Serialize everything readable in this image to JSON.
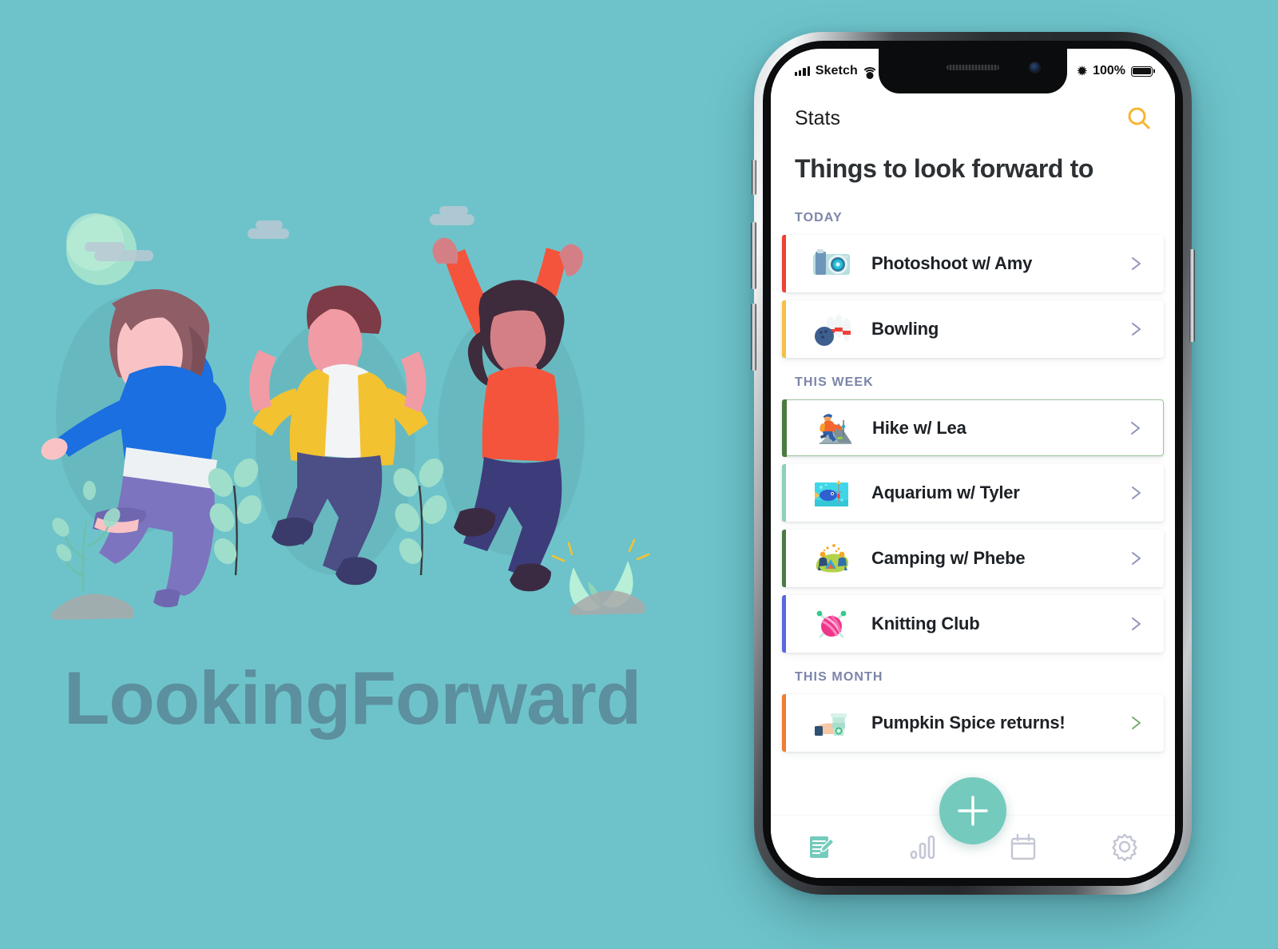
{
  "background": {
    "brand_title": "LookingForward",
    "bg_color": "#6ec3ca",
    "brand_color": "#5b8c9b"
  },
  "status_bar": {
    "carrier": "Sketch",
    "battery_percent": "100%",
    "signal_icon": "signal-bars-icon",
    "wifi_icon": "wifi-icon",
    "bluetooth_icon": "bluetooth-icon",
    "battery_icon": "battery-icon"
  },
  "navbar": {
    "title": "Stats",
    "search_icon": "search-icon",
    "search_color": "#f5b731"
  },
  "page": {
    "heading": "Things to look forward to"
  },
  "sections": [
    {
      "label": "TODAY",
      "items": [
        {
          "label": "Photoshoot w/ Amy",
          "icon": "camera-icon",
          "accent": "#ef4136",
          "selected": false,
          "chevron": "chevron-right-icon"
        },
        {
          "label": "Bowling",
          "icon": "bowling-icon",
          "accent": "#f5c144",
          "selected": false,
          "chevron": "chevron-right-icon"
        }
      ]
    },
    {
      "label": "THIS WEEK",
      "items": [
        {
          "label": "Hike w/ Lea",
          "icon": "hiking-icon",
          "accent": "#4c7a3f",
          "selected": true,
          "chevron": "chevron-right-icon"
        },
        {
          "label": "Aquarium w/ Tyler",
          "icon": "aquarium-icon",
          "accent": "#8ed0be",
          "selected": false,
          "chevron": "chevron-right-icon"
        },
        {
          "label": "Camping w/ Phebe",
          "icon": "camping-icon",
          "accent": "#4c7a3f",
          "selected": false,
          "chevron": "chevron-right-icon"
        },
        {
          "label": "Knitting Club",
          "icon": "knitting-icon",
          "accent": "#5b68e0",
          "selected": false,
          "chevron": "chevron-right-icon"
        }
      ]
    },
    {
      "label": "THIS MONTH",
      "items": [
        {
          "label": "Pumpkin Spice returns!",
          "icon": "coffee-cup-icon",
          "accent": "#f07d32",
          "selected": false,
          "chevron": "chevron-right-icon"
        }
      ]
    }
  ],
  "fab": {
    "icon": "plus-icon",
    "color": "#74cbbd"
  },
  "tabbar": {
    "items": [
      {
        "name": "notes",
        "icon": "notes-edit-icon",
        "active": true
      },
      {
        "name": "stats",
        "icon": "bar-chart-icon",
        "active": false
      },
      {
        "name": "calendar",
        "icon": "calendar-icon",
        "active": false
      },
      {
        "name": "settings",
        "icon": "gear-icon",
        "active": false
      }
    ],
    "active_color": "#74cbbd",
    "inactive_color": "#c3c6d4"
  }
}
